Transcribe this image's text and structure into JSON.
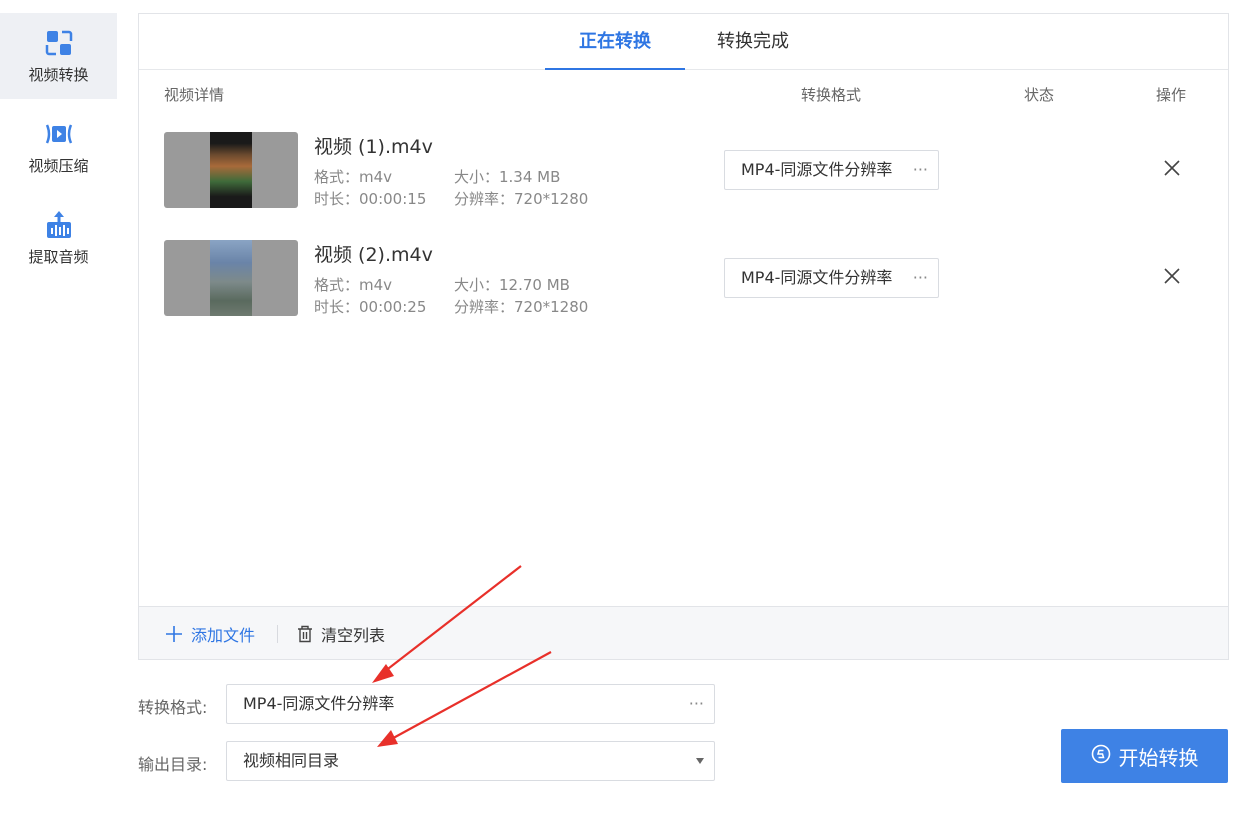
{
  "sidebar": {
    "items": [
      {
        "label": "视频转换",
        "icon": "convert-icon",
        "active": true
      },
      {
        "label": "视频压缩",
        "icon": "compress-icon",
        "active": false
      },
      {
        "label": "提取音频",
        "icon": "audio-extract-icon",
        "active": false
      }
    ]
  },
  "tabs": {
    "converting": "正在转换",
    "completed": "转换完成"
  },
  "columns": {
    "details": "视频详情",
    "format": "转换格式",
    "status": "状态",
    "actions": "操作"
  },
  "files": [
    {
      "name": "视频 (1).m4v",
      "format": "格式：m4v",
      "size": "大小：1.34 MB",
      "duration": "时长：00:00:15",
      "resolution": "分辨率：720*1280",
      "target_format": "MP4-同源文件分辨率",
      "dots": "···"
    },
    {
      "name": "视频 (2).m4v",
      "format": "格式：m4v",
      "size": "大小：12.70 MB",
      "duration": "时长：00:00:25",
      "resolution": "分辨率：720*1280",
      "target_format": "MP4-同源文件分辨率",
      "dots": "···"
    }
  ],
  "footer": {
    "add_file": "添加文件",
    "clear_list": "清空列表"
  },
  "settings": {
    "format_label": "转换格式:",
    "format_value": "MP4-同源文件分辨率",
    "format_dots": "···",
    "output_label": "输出目录:",
    "output_value": "视频相同目录"
  },
  "start_button": "开始转换",
  "colors": {
    "accent": "#2f76e3",
    "button": "#3e82e5",
    "arrow": "#e8302a"
  }
}
